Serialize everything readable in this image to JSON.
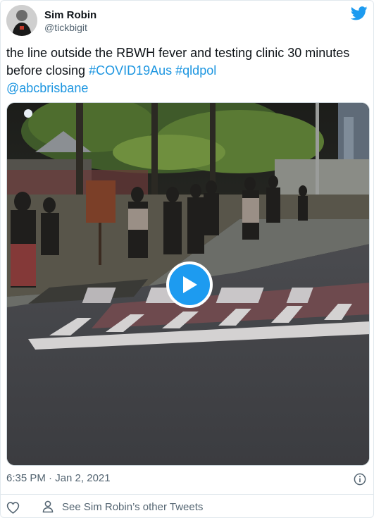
{
  "author": {
    "name": "Sim Robin",
    "handle": "@tickbigit"
  },
  "tweet": {
    "text_parts": [
      "the line outside the RBWH fever and testing clinic 30 minutes before closing ",
      "#COVID19Aus",
      " ",
      "#qldpol",
      "@abcbrisbane"
    ]
  },
  "media": {
    "type": "video",
    "play_icon": "play-icon"
  },
  "meta": {
    "timestamp": "6:35 PM · Jan 2, 2021",
    "info_icon": "info-icon"
  },
  "actions": {
    "like_icon": "heart-icon",
    "see_other_icon": "person-icon",
    "see_other_label": "See Sim Robin’s other Tweets"
  },
  "colors": {
    "link": "#1b95e0",
    "brand": "#1d9bf0",
    "text": "#0f1419",
    "secondary": "#536471"
  }
}
